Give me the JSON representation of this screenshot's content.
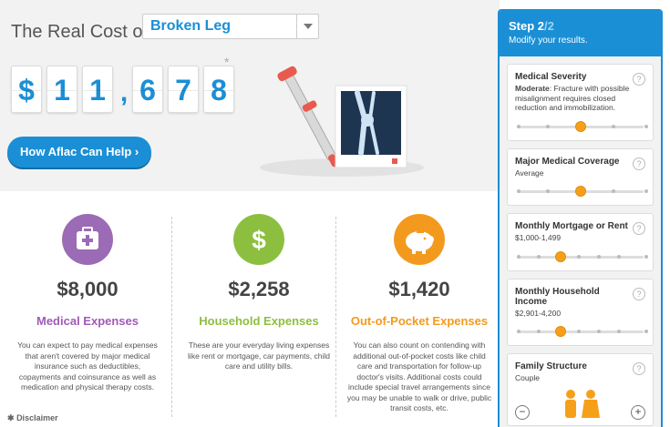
{
  "header": {
    "title": "The Real Cost of",
    "condition_selected": "Broken Leg",
    "total_digits": [
      "$",
      "1",
      "1",
      ",",
      "6",
      "7",
      "8"
    ],
    "asterisk": "*",
    "help_button": "How Aflac Can Help  ›"
  },
  "columns": [
    {
      "icon": "medical-kit-icon",
      "color": "#9b6bb5",
      "amount": "$8,000",
      "label": "Medical Expenses",
      "label_color": "#a05ab8",
      "desc": "You can expect to pay medical expenses that aren't covered by major medical insurance such as deductibles, copayments and coinsurance as well as medication and physical therapy costs."
    },
    {
      "icon": "dollar-sign-icon",
      "color": "#8cbf3f",
      "amount": "$2,258",
      "label": "Household Expenses",
      "label_color": "#8cbf3f",
      "desc": "These are your everyday living expenses like rent or mortgage, car payments, child care and utility bills."
    },
    {
      "icon": "piggy-bank-icon",
      "color": "#f39a1e",
      "amount": "$1,420",
      "label": "Out-of-Pocket Expenses",
      "label_color": "#f39a1e",
      "desc": "You can also count on contending with additional out-of-pocket costs like child care and transportation for follow-up doctor's visits. Additional costs could include special travel arrangements since you may be unable to walk or drive, public transit costs, etc."
    }
  ],
  "disclaimer": "Disclaimer",
  "panel": {
    "step": "Step 2",
    "step_total": "/2",
    "subtitle": "Modify your results.",
    "severity": {
      "title": "Medical Severity",
      "level": "Moderate",
      "desc": ": Fracture with possible misalignment requires closed reduction and immobilization.",
      "position": 0.5
    },
    "coverage": {
      "title": "Major Medical Coverage",
      "value": "Average",
      "position": 0.5
    },
    "mortgage": {
      "title": "Monthly Mortgage or Rent",
      "value": "$1,000-1,499",
      "position": 0.33
    },
    "income": {
      "title": "Monthly Household Income",
      "value": "$2,901-4,200",
      "position": 0.33
    },
    "family": {
      "title": "Family Structure",
      "value": "Couple",
      "minus": "−",
      "plus": "+"
    },
    "help": "?"
  },
  "colors": {
    "accent": "#1a8fd6",
    "knob": "#f6a01a"
  }
}
